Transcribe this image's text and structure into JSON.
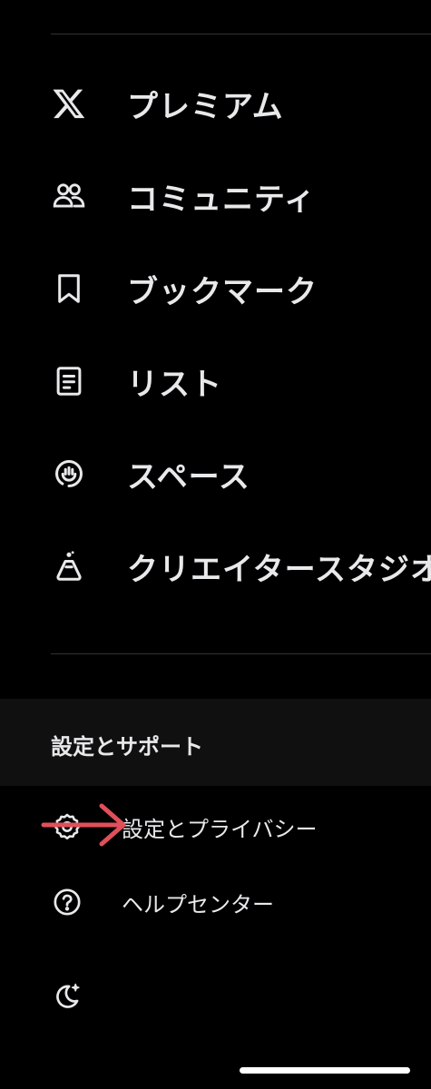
{
  "menu": {
    "items": [
      {
        "icon": "x-logo-icon",
        "label": "プレミアム"
      },
      {
        "icon": "people-icon",
        "label": "コミュニティ"
      },
      {
        "icon": "bookmark-icon",
        "label": "ブックマーク"
      },
      {
        "icon": "list-icon",
        "label": "リスト"
      },
      {
        "icon": "spaces-microphone-icon",
        "label": "スペース"
      },
      {
        "icon": "flask-icon",
        "label": "クリエイタースタジオ"
      }
    ]
  },
  "settings_section": {
    "title": "設定とサポート",
    "items": [
      {
        "icon": "gear-icon",
        "label": "設定とプライバシー"
      },
      {
        "icon": "help-circle-icon",
        "label": "ヘルプセンター"
      },
      {
        "icon": "moon-icon",
        "label": ""
      }
    ]
  },
  "colors": {
    "background": "#000000",
    "text": "#e7e9ea",
    "divider": "#2f3336",
    "section_background": "#101010",
    "annotation_arrow": "#e0505a"
  }
}
